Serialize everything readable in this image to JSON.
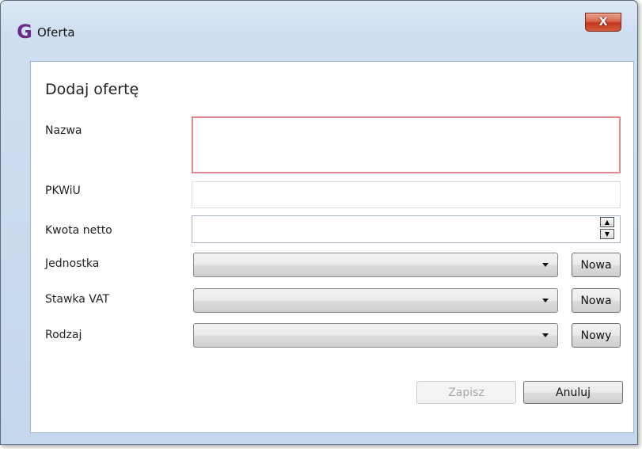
{
  "window": {
    "title": "Oferta",
    "logo_letter": "G",
    "logo_color": "#6a2d86",
    "close_label": "X"
  },
  "form": {
    "heading": "Dodaj ofertę",
    "fields": {
      "nazwa": {
        "label": "Nazwa",
        "value": ""
      },
      "pkwiu": {
        "label": "PKWiU",
        "value": ""
      },
      "kwota": {
        "label": "Kwota netto",
        "value": ""
      },
      "jednostka": {
        "label": "Jednostka",
        "selected": "",
        "button": "Nowa"
      },
      "stawka": {
        "label": "Stawka VAT",
        "selected": "",
        "button": "Nowa"
      },
      "rodzaj": {
        "label": "Rodzaj",
        "selected": "",
        "button": "Nowy"
      }
    },
    "error_color": "#e4868b"
  },
  "actions": {
    "save": "Zapisz",
    "cancel": "Anuluj"
  }
}
